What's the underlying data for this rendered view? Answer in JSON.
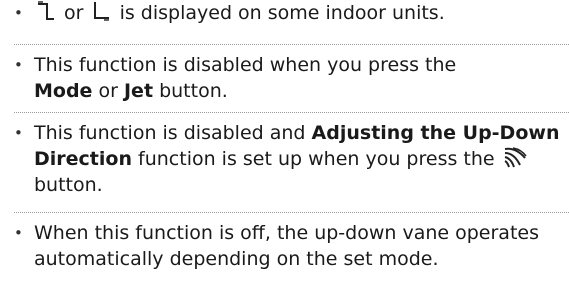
{
  "notes": {
    "bullet": "•",
    "item1": {
      "conj": "or",
      "text": "is displayed on some indoor units.",
      "icons": [
        "vane-segment-top-right-icon",
        "vane-segment-bottom-left-icon"
      ]
    },
    "item2": {
      "text_a": "This function is disabled when you press the",
      "bold_1": "Mode",
      "conj": "or",
      "bold_2": "Jet",
      "text_b": "button."
    },
    "item3": {
      "text_a": "This function is disabled and",
      "bold_1": "Adjusting the Up-Down Direction",
      "text_b": "function is set up when you press the",
      "text_c": "button.",
      "icon": "swing-vane-icon"
    },
    "item4": {
      "text": "When this function is off, the up-down vane operates automatically depending on the set mode."
    }
  }
}
